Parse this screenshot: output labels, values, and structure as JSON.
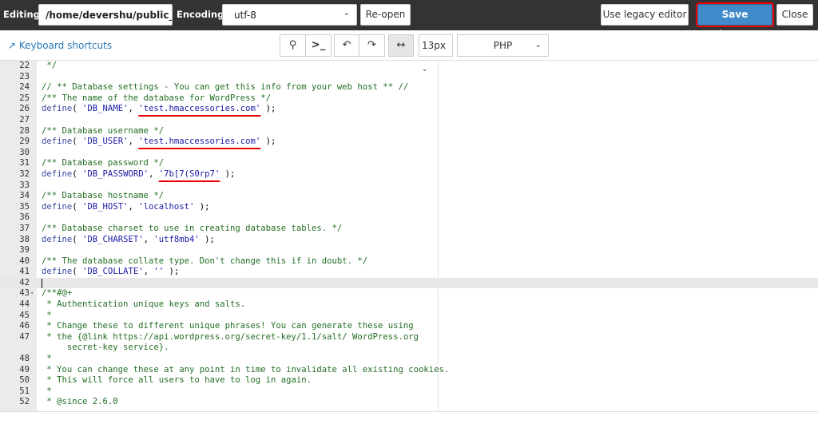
{
  "topbar": {
    "editing_label": "Editing:",
    "path": "/home/devershu/public_h",
    "encoding_label": "Encoding:",
    "encoding": "utf-8",
    "reopen": "Re-open",
    "legacy": "Use legacy editor",
    "save": "Save Changes",
    "close": "Close"
  },
  "toolbar": {
    "shortcuts": "Keyboard shortcuts",
    "font_size": "13px",
    "mode": "PHP"
  },
  "colors": {
    "accent": "#428bca",
    "highlight": "#ee0000"
  },
  "lines": [
    {
      "n": "22",
      "t": [
        {
          "c": "c",
          "v": " */"
        }
      ]
    },
    {
      "n": "23",
      "t": []
    },
    {
      "n": "24",
      "t": [
        {
          "c": "c",
          "v": "// ** Database settings - You can get this info from your web host ** //"
        }
      ]
    },
    {
      "n": "25",
      "t": [
        {
          "c": "c",
          "v": "/** The name of the database for WordPress */"
        }
      ]
    },
    {
      "n": "26",
      "t": [
        {
          "c": "k",
          "v": "define"
        },
        {
          "c": "p",
          "v": "( "
        },
        {
          "c": "s",
          "v": "'DB_NAME'"
        },
        {
          "c": "p",
          "v": ", "
        },
        {
          "c": "s ul",
          "v": "'test.hmaccessories.com'"
        },
        {
          "c": "p",
          "v": " );"
        }
      ]
    },
    {
      "n": "27",
      "t": []
    },
    {
      "n": "28",
      "t": [
        {
          "c": "c",
          "v": "/** Database username */"
        }
      ]
    },
    {
      "n": "29",
      "t": [
        {
          "c": "k",
          "v": "define"
        },
        {
          "c": "p",
          "v": "( "
        },
        {
          "c": "s",
          "v": "'DB_USER'"
        },
        {
          "c": "p",
          "v": ", "
        },
        {
          "c": "s ul",
          "v": "'test.hmaccessories.com'"
        },
        {
          "c": "p",
          "v": " );"
        }
      ]
    },
    {
      "n": "30",
      "t": []
    },
    {
      "n": "31",
      "t": [
        {
          "c": "c",
          "v": "/** Database password */"
        }
      ]
    },
    {
      "n": "32",
      "t": [
        {
          "c": "k",
          "v": "define"
        },
        {
          "c": "p",
          "v": "( "
        },
        {
          "c": "s",
          "v": "'DB_PASSWORD'"
        },
        {
          "c": "p",
          "v": ", "
        },
        {
          "c": "s ul",
          "v": "'7b[7(S0rp7'"
        },
        {
          "c": "p",
          "v": " );"
        }
      ]
    },
    {
      "n": "33",
      "t": []
    },
    {
      "n": "34",
      "t": [
        {
          "c": "c",
          "v": "/** Database hostname */"
        }
      ]
    },
    {
      "n": "35",
      "t": [
        {
          "c": "k",
          "v": "define"
        },
        {
          "c": "p",
          "v": "( "
        },
        {
          "c": "s",
          "v": "'DB_HOST'"
        },
        {
          "c": "p",
          "v": ", "
        },
        {
          "c": "s",
          "v": "'localhost'"
        },
        {
          "c": "p",
          "v": " );"
        }
      ]
    },
    {
      "n": "36",
      "t": []
    },
    {
      "n": "37",
      "t": [
        {
          "c": "c",
          "v": "/** Database charset to use in creating database tables. */"
        }
      ]
    },
    {
      "n": "38",
      "t": [
        {
          "c": "k",
          "v": "define"
        },
        {
          "c": "p",
          "v": "( "
        },
        {
          "c": "s",
          "v": "'DB_CHARSET'"
        },
        {
          "c": "p",
          "v": ", "
        },
        {
          "c": "s",
          "v": "'utf8mb4'"
        },
        {
          "c": "p",
          "v": " );"
        }
      ]
    },
    {
      "n": "39",
      "t": []
    },
    {
      "n": "40",
      "t": [
        {
          "c": "c",
          "v": "/** The database collate type. Don't change this if in doubt. */"
        }
      ]
    },
    {
      "n": "41",
      "t": [
        {
          "c": "k",
          "v": "define"
        },
        {
          "c": "p",
          "v": "( "
        },
        {
          "c": "s",
          "v": "'DB_COLLATE'"
        },
        {
          "c": "p",
          "v": ", "
        },
        {
          "c": "s",
          "v": "''"
        },
        {
          "c": "p",
          "v": " );"
        }
      ]
    },
    {
      "n": "42",
      "t": [],
      "active": true
    },
    {
      "n": "43",
      "t": [
        {
          "c": "c",
          "v": "/**#@+"
        }
      ],
      "fold": true
    },
    {
      "n": "44",
      "t": [
        {
          "c": "c",
          "v": " * Authentication unique keys and salts."
        }
      ]
    },
    {
      "n": "45",
      "t": [
        {
          "c": "c",
          "v": " *"
        }
      ]
    },
    {
      "n": "46",
      "t": [
        {
          "c": "c",
          "v": " * Change these to different unique phrases! You can generate these using"
        }
      ]
    },
    {
      "n": "47",
      "t": [
        {
          "c": "c",
          "v": " * the {@link https://api.wordpress.org/secret-key/1.1/salt/ WordPress.org"
        }
      ],
      "cont": "     secret-key service}."
    },
    {
      "n": "48",
      "t": [
        {
          "c": "c",
          "v": " *"
        }
      ]
    },
    {
      "n": "49",
      "t": [
        {
          "c": "c",
          "v": " * You can change these at any point in time to invalidate all existing cookies."
        }
      ]
    },
    {
      "n": "50",
      "t": [
        {
          "c": "c",
          "v": " * This will force all users to have to log in again."
        }
      ]
    },
    {
      "n": "51",
      "t": [
        {
          "c": "c",
          "v": " *"
        }
      ]
    },
    {
      "n": "52",
      "t": [
        {
          "c": "c",
          "v": " * @since 2.6.0"
        }
      ]
    }
  ]
}
